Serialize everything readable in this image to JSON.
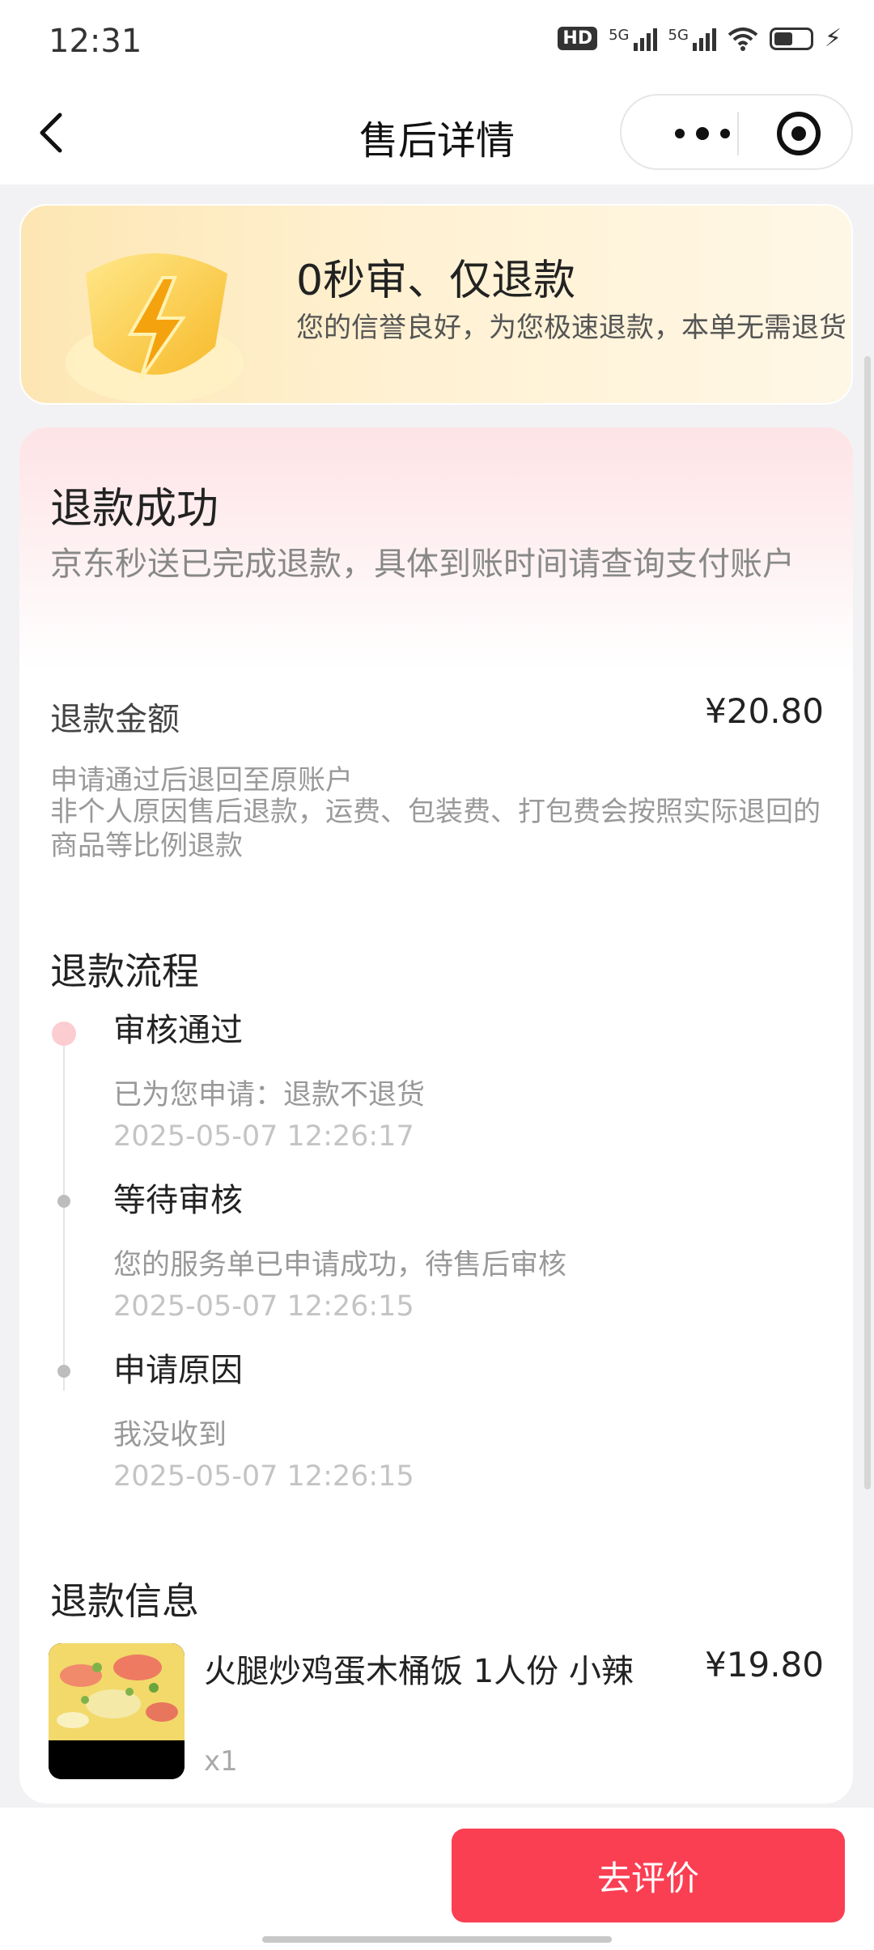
{
  "statusbar": {
    "time": "12:31",
    "network_label": "5G",
    "hd_label": "HD"
  },
  "navbar": {
    "title": "售后详情"
  },
  "banner": {
    "title": "0秒审、仅退款",
    "subtitle": "您的信誉良好，为您极速退款，本单无需退货"
  },
  "status": {
    "title": "退款成功",
    "desc": "京东秒送已完成退款，具体到账时间请查询支付账户"
  },
  "amount": {
    "label": "退款金额",
    "value": "¥20.80",
    "note1": "申请通过后退回至原账户",
    "note2": "非个人原因售后退款，运费、包装费、打包费会按照实际退回的商品等比例退款"
  },
  "process": {
    "title": "退款流程",
    "steps": [
      {
        "title": "审核通过",
        "desc": "已为您申请：退款不退货",
        "time": "2025-05-07 12:26:17"
      },
      {
        "title": "等待审核",
        "desc": "您的服务单已申请成功，待售后审核",
        "time": "2025-05-07 12:26:15"
      },
      {
        "title": "申请原因",
        "desc": "我没收到",
        "time": "2025-05-07 12:26:15"
      }
    ]
  },
  "info": {
    "title": "退款信息",
    "product": {
      "name": "火腿炒鸡蛋木桶饭 1人份 小辣",
      "price": "¥19.80",
      "qty": "x1"
    }
  },
  "bottom": {
    "review_button": "去评价"
  },
  "colors": {
    "accent": "#fa3f53",
    "banner_bg": "#fde6b3",
    "status_bg": "#fde3e6"
  }
}
